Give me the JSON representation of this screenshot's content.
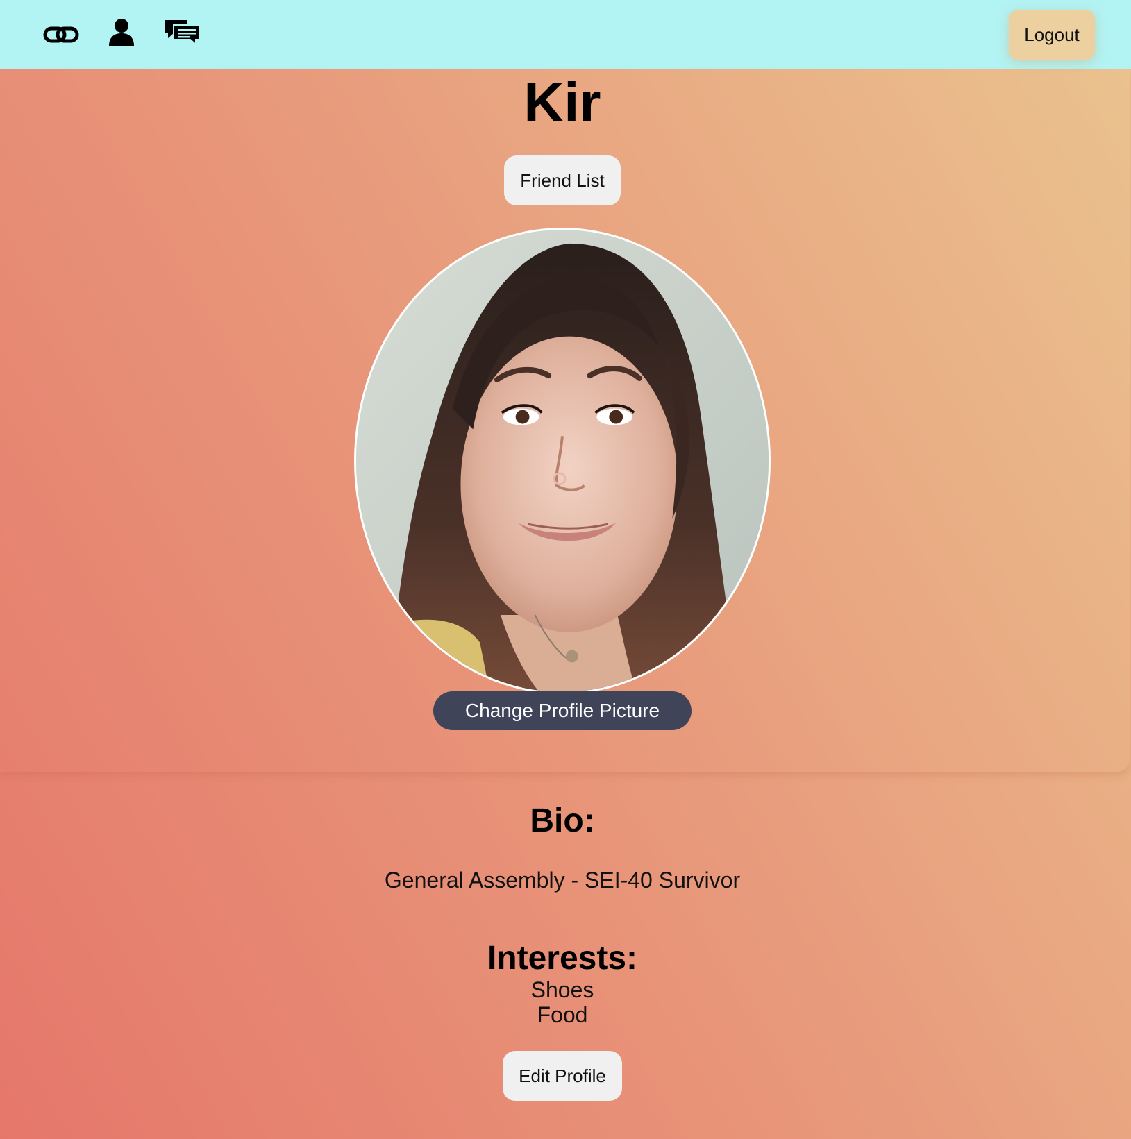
{
  "nav": {
    "icons": [
      "link-icon",
      "user-icon",
      "chat-icon"
    ],
    "logout_label": "Logout"
  },
  "profile": {
    "name": "Kir",
    "friend_list_label": "Friend List",
    "change_picture_label": "Change Profile Picture",
    "bio_heading": "Bio:",
    "bio_text": "General Assembly - SEI-40 Survivor",
    "interests_heading": "Interests:",
    "interests": [
      "Shoes",
      "Food"
    ],
    "edit_profile_label": "Edit Profile"
  },
  "colors": {
    "navbar_bg": "#b2f3f3",
    "logout_bg": "#ecd09f",
    "change_picture_bg": "#3f4459",
    "pill_button_bg": "#f0f0f0",
    "gradient_start": "#e5776a",
    "gradient_end": "#eac48f"
  }
}
